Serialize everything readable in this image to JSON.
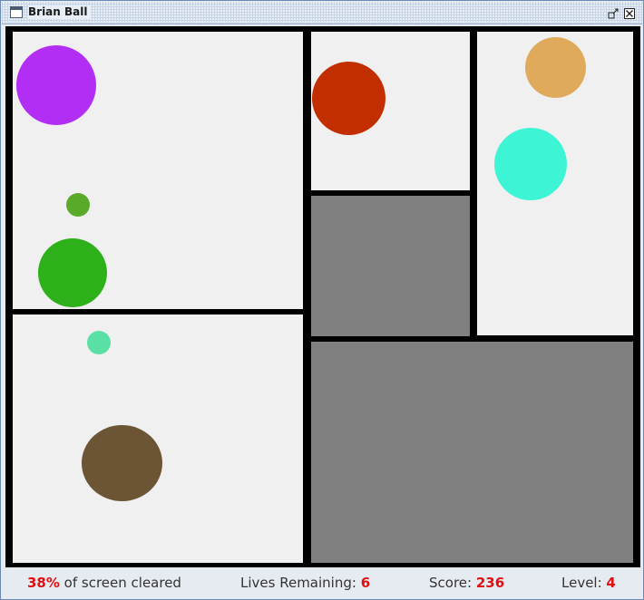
{
  "window": {
    "title": "Brian Ball"
  },
  "status": {
    "cleared_value": "38%",
    "cleared_label": " of screen cleared",
    "lives_label": "Lives Remaining: ",
    "lives_value": "6",
    "score_label": "Score: ",
    "score_value": "236",
    "level_label": "Level: ",
    "level_value": "4"
  },
  "game": {
    "open_region_color": "#f0f0f0",
    "cleared_region_color": "#808080",
    "wall_color": "#000000",
    "regions": [
      {
        "id": "top-left",
        "state": "open"
      },
      {
        "id": "bottom-left",
        "state": "open"
      },
      {
        "id": "top-middle",
        "state": "open"
      },
      {
        "id": "middle",
        "state": "cleared"
      },
      {
        "id": "right",
        "state": "open"
      },
      {
        "id": "bottom-right",
        "state": "cleared"
      }
    ],
    "balls": [
      {
        "name": "purple",
        "color": "#b32ef5"
      },
      {
        "name": "small-green",
        "color": "#5aaa2a"
      },
      {
        "name": "green",
        "color": "#2db01a"
      },
      {
        "name": "mint",
        "color": "#5ae0a4"
      },
      {
        "name": "brown",
        "color": "#6b5535"
      },
      {
        "name": "red",
        "color": "#c22e00"
      },
      {
        "name": "tan",
        "color": "#e0aa5c"
      },
      {
        "name": "cyan",
        "color": "#3df5d5"
      }
    ]
  }
}
